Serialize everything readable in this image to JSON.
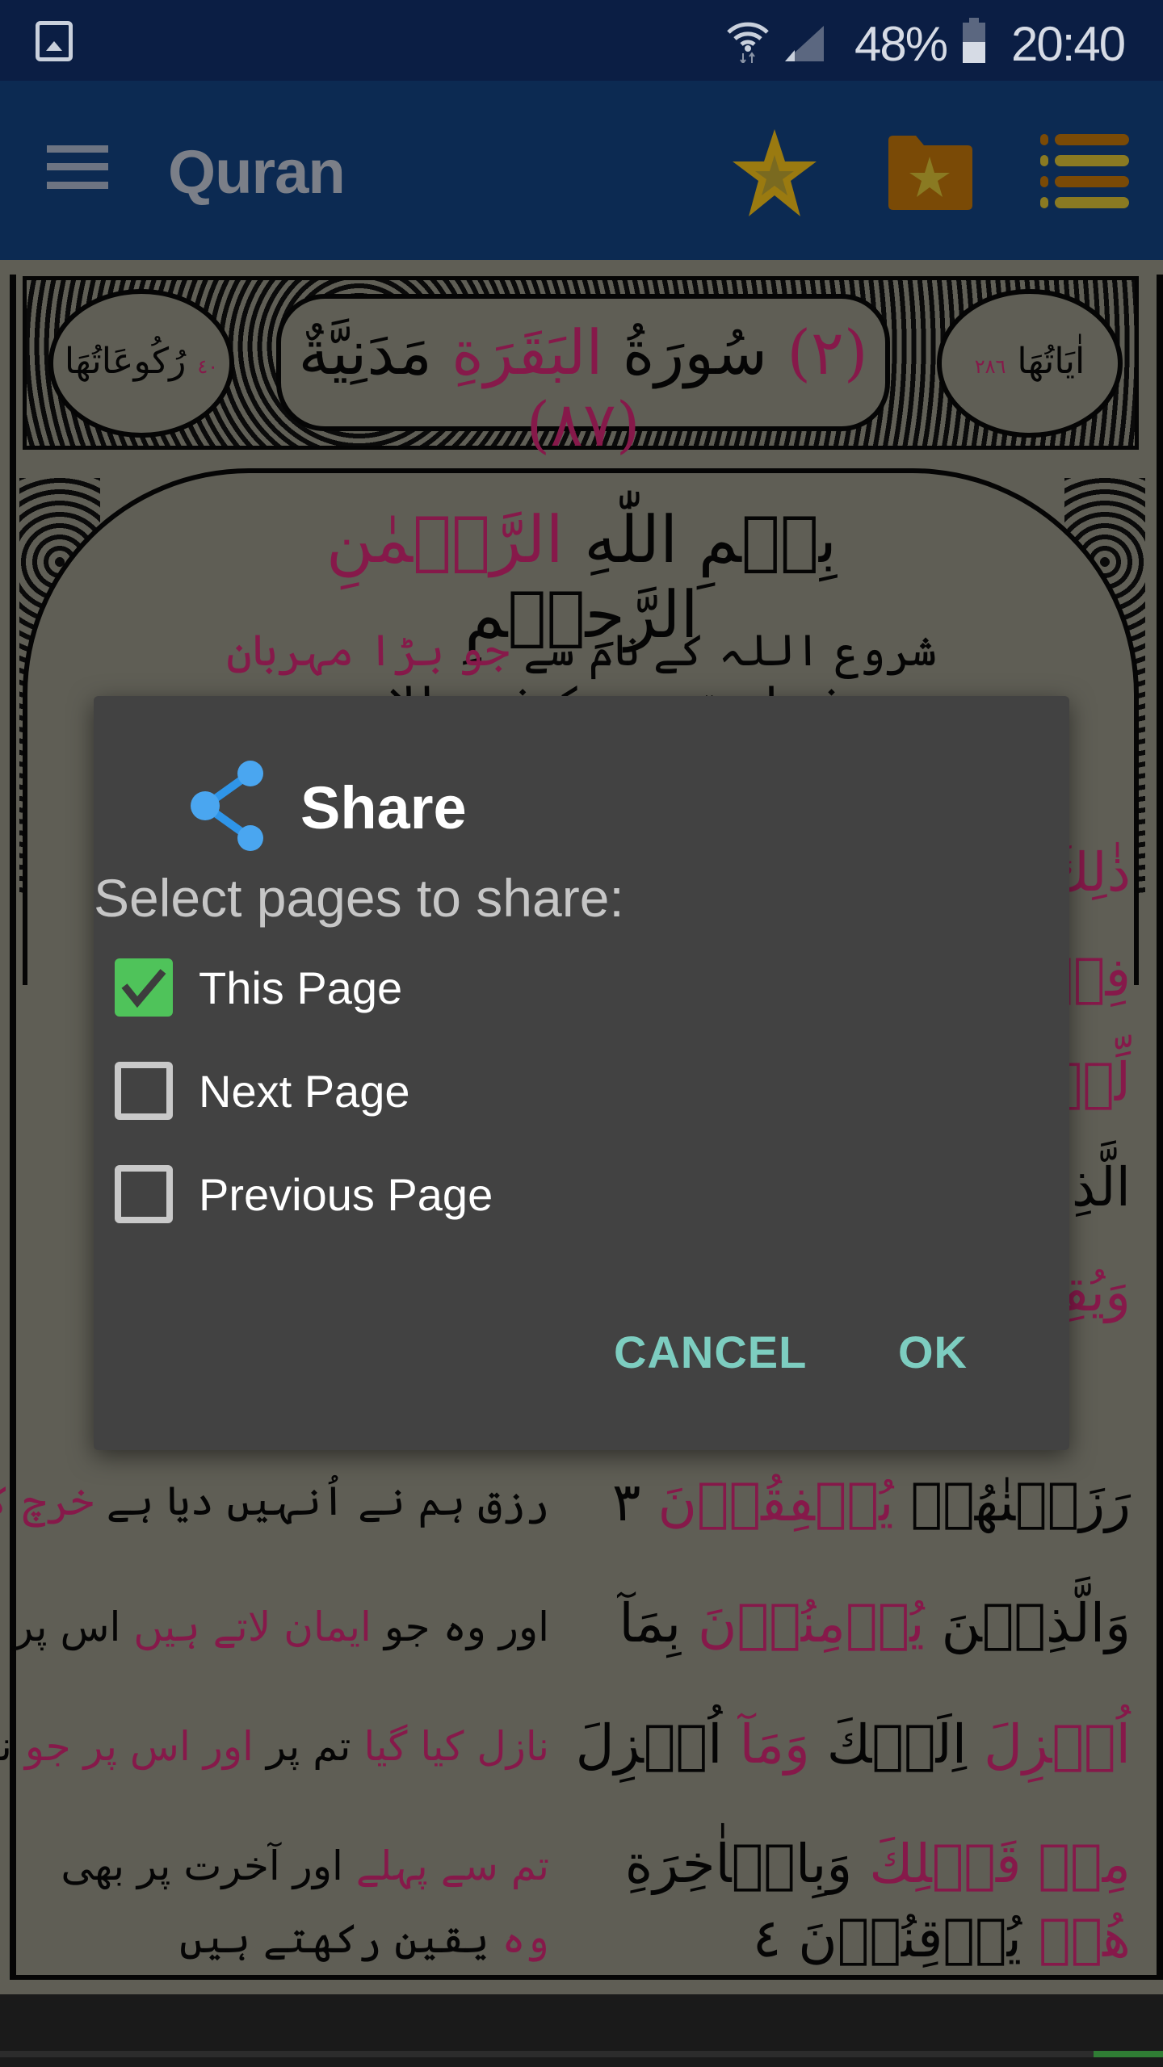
{
  "status_bar": {
    "battery_percent": "48%",
    "time": "20:40",
    "icons": [
      "gallery-notification-icon",
      "wifi-icon",
      "signal-icon",
      "battery-icon"
    ]
  },
  "app_bar": {
    "title": "Quran",
    "icons": [
      "menu-icon",
      "bookmark-star-icon",
      "bookmark-folder-icon",
      "list-icon"
    ]
  },
  "quran_page": {
    "surah_header": {
      "number": "(٢)",
      "name_prefix": "سُورَةُ",
      "name": "البَقَرَةِ",
      "type": "مَدَنِيَّةٌ",
      "revelation_order": "(٨٧)",
      "ayat_label": "اٰيَاتُهَا",
      "ayat_count": "٢٨٦",
      "ruku_label": "رُكُوعَاتُهَا",
      "ruku_count": "٤٠"
    },
    "bismillah": {
      "part1": "بِسۡمِ اللّٰهِ",
      "part2": "الرَّحۡمٰنِ",
      "part3": "الرَّحِيۡمِ"
    },
    "bismillah_urdu": {
      "part1": "شروع اللہ کے نام سے",
      "part2": "جو بڑا مہربان",
      "part3": "نہایت رحم کرنے والا ہے"
    },
    "arabic_lines_visible_right": [
      "ذٰلِكَ",
      "فِيۡهِ",
      "لِّلۡمُتَّقِيۡنَ",
      "الَّذِيۡنَ",
      "وَيُقِيۡمُوۡنَ"
    ],
    "lines": [
      {
        "arabic": "رَزَقۡنٰهُمۡ",
        "arabic_red": "يُنۡفِقُوۡنَ",
        "ayah": "٣",
        "urdu": "رزق ہم نے اُنہیں دیا ہے",
        "urdu_red": "خرچ کرتے ہیں"
      },
      {
        "arabic": "وَالَّذِيۡنَ",
        "arabic_red": "يُؤۡمِنُوۡنَ",
        "arabic_end": "بِمَآ",
        "urdu": "اور وہ جو",
        "urdu_red": "ایمان لاتے ہیں",
        "urdu_end": "اس پر جو"
      },
      {
        "arabic_red": "اُنۡزِلَ",
        "arabic": "اِلَيۡكَ",
        "arabic_red2": "وَمَآ",
        "arabic_end": "اُنۡزِلَ",
        "urdu_red": "نازل کیا گیا",
        "urdu": "تم پر",
        "urdu_red2": "اور اس پر جو",
        "urdu_end": "نازل کیا گیا"
      },
      {
        "arabic_red": "مِنۡ قَبۡلِكَ",
        "arabic": "وَبِالۡاٰخِرَةِ",
        "urdu_red": "تم سے پہلے",
        "urdu": "اور آخرت پر بھی"
      },
      {
        "arabic_red": "هُمۡ",
        "arabic": "يُوۡقِنُوۡنَ",
        "ayah": "٤",
        "urdu_red": "وہ",
        "urdu": "یقین رکھتے ہیں"
      }
    ]
  },
  "dialog": {
    "title": "Share",
    "icon": "share-icon",
    "message": "Select pages to share:",
    "options": [
      {
        "label": "This Page",
        "checked": true
      },
      {
        "label": "Next Page",
        "checked": false
      },
      {
        "label": "Previous Page",
        "checked": false
      }
    ],
    "cancel_label": "CANCEL",
    "ok_label": "OK"
  },
  "reading_progress": {
    "fraction": 0.06,
    "direction": "right-to-left"
  },
  "colors": {
    "status_bar": "#0b1e44",
    "app_bar": "#0c2a52",
    "dialog_bg": "#424242",
    "checkbox_checked": "#4fc35a",
    "button_text": "#7dcdc0",
    "share_icon": "#2f95e8",
    "quran_red": "#86194a",
    "star_gold": "#9a7a10"
  }
}
